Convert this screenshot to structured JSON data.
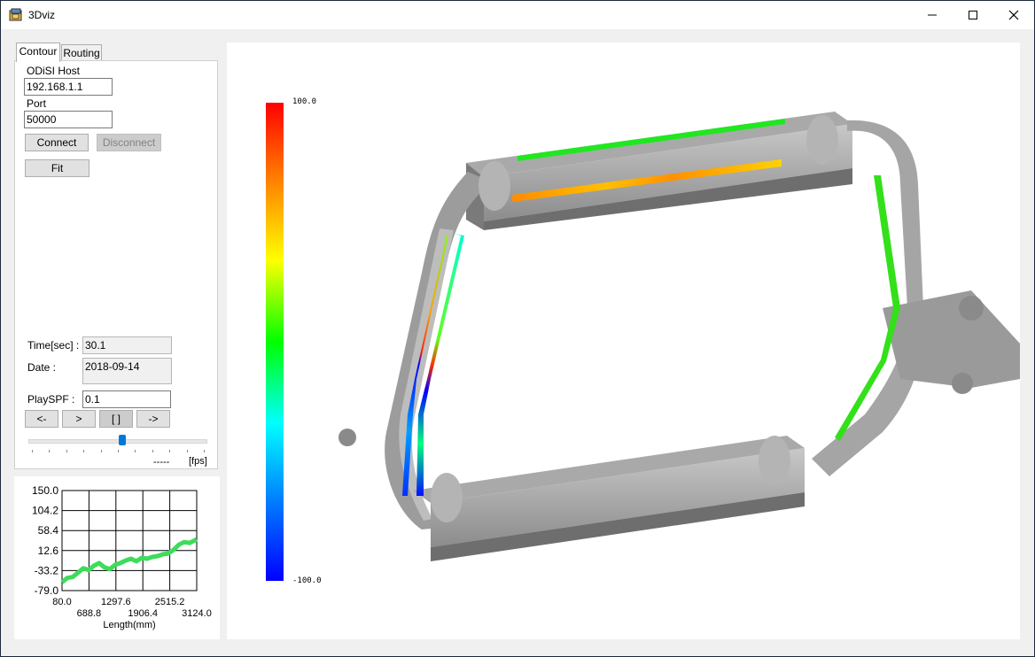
{
  "window": {
    "title": "3Dviz"
  },
  "tabs": [
    {
      "label": "Contour"
    },
    {
      "label": "Routing"
    }
  ],
  "connection": {
    "host_label": "ODiSI Host",
    "host_value": "192.168.1.1",
    "port_label": "Port",
    "port_value": "50000",
    "connect_label": "Connect",
    "disconnect_label": "Disconnect",
    "fit_label": "Fit"
  },
  "playback": {
    "time_label": "Time[sec] :",
    "time_value": "30.1",
    "date_label": "Date :",
    "date_value": "2018-09-14",
    "playspf_label": "PlaySPF :",
    "playspf_value": "0.1",
    "prev_label": "<-",
    "play_label": ">",
    "stop_label": "[ ]",
    "next_label": "->",
    "fps_value": "-----",
    "fps_unit": "[fps]",
    "slider_fraction": 0.53
  },
  "colorbar": {
    "max_label": "100.0",
    "min_label": "-100.0"
  },
  "chart_data": {
    "type": "line",
    "xlabel": "Length(mm)",
    "xlim": [
      80.0,
      3124.0
    ],
    "ylim": [
      -79.0,
      150.0
    ],
    "yticks": [
      "150.0",
      "104.2",
      "58.4",
      "12.6",
      "-33.2",
      "-79.0"
    ],
    "xticks_top": [
      "80.0",
      "1297.6",
      "2515.2"
    ],
    "xticks_bottom": [
      "688.8",
      "1906.4",
      "3124.0"
    ],
    "grid": true,
    "series": [
      {
        "color": "#3ddc5a",
        "x": [
          80,
          200,
          320,
          440,
          560,
          680,
          800,
          920,
          1040,
          1160,
          1280,
          1400,
          1520,
          1640,
          1760,
          1880,
          2000,
          2120,
          2240,
          2360,
          2480,
          2600,
          2720,
          2840,
          2960,
          3080,
          3124
        ],
        "y": [
          -60,
          -50,
          -48,
          -38,
          -28,
          -32,
          -22,
          -16,
          -26,
          -30,
          -20,
          -16,
          -10,
          -6,
          -12,
          -4,
          -6,
          -2,
          0,
          4,
          6,
          14,
          26,
          32,
          30,
          36,
          38
        ]
      }
    ]
  }
}
